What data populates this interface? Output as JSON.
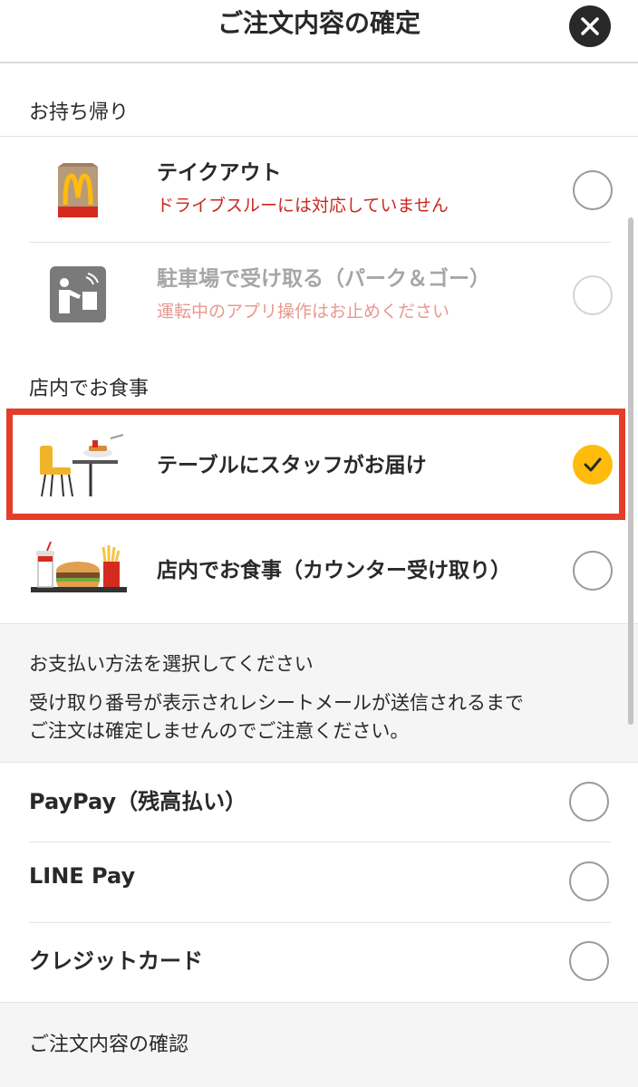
{
  "header": {
    "title": "ご注文内容の確定"
  },
  "takeout": {
    "heading": "お持ち帰り",
    "options": [
      {
        "title": "テイクアウト",
        "subtitle": "ドライブスルーには対応していません",
        "icon": "takeout-bag-icon",
        "selected": false,
        "disabled": false
      },
      {
        "title": "駐車場で受け取る（パーク＆ゴー）",
        "subtitle": "運転中のアプリ操作はお止めください",
        "icon": "park-and-go-icon",
        "selected": false,
        "disabled": true
      }
    ]
  },
  "dine_in": {
    "heading": "店内でお食事",
    "options": [
      {
        "title": "テーブルにスタッフがお届け",
        "icon": "table-delivery-icon",
        "selected": true,
        "disabled": false
      },
      {
        "title": "店内でお食事（カウンター受け取り）",
        "icon": "counter-pickup-icon",
        "selected": false,
        "disabled": false
      }
    ]
  },
  "payment_notice": {
    "lines": [
      "お支払い方法を選択してください",
      "受け取り番号が表示されレシートメールが送信されるまで",
      "ご注文は確定しませんのでご注意ください。"
    ]
  },
  "payment_methods": [
    {
      "label": "PayPay（残高払い）",
      "selected": false
    },
    {
      "label": "LINE Pay",
      "selected": false
    },
    {
      "label": "クレジットカード",
      "selected": false
    }
  ],
  "footer": {
    "label": "ご注文内容の確認"
  },
  "colors": {
    "accent": "#ffbc0d",
    "highlight": "#e53d2a",
    "warning": "#c8281e"
  }
}
